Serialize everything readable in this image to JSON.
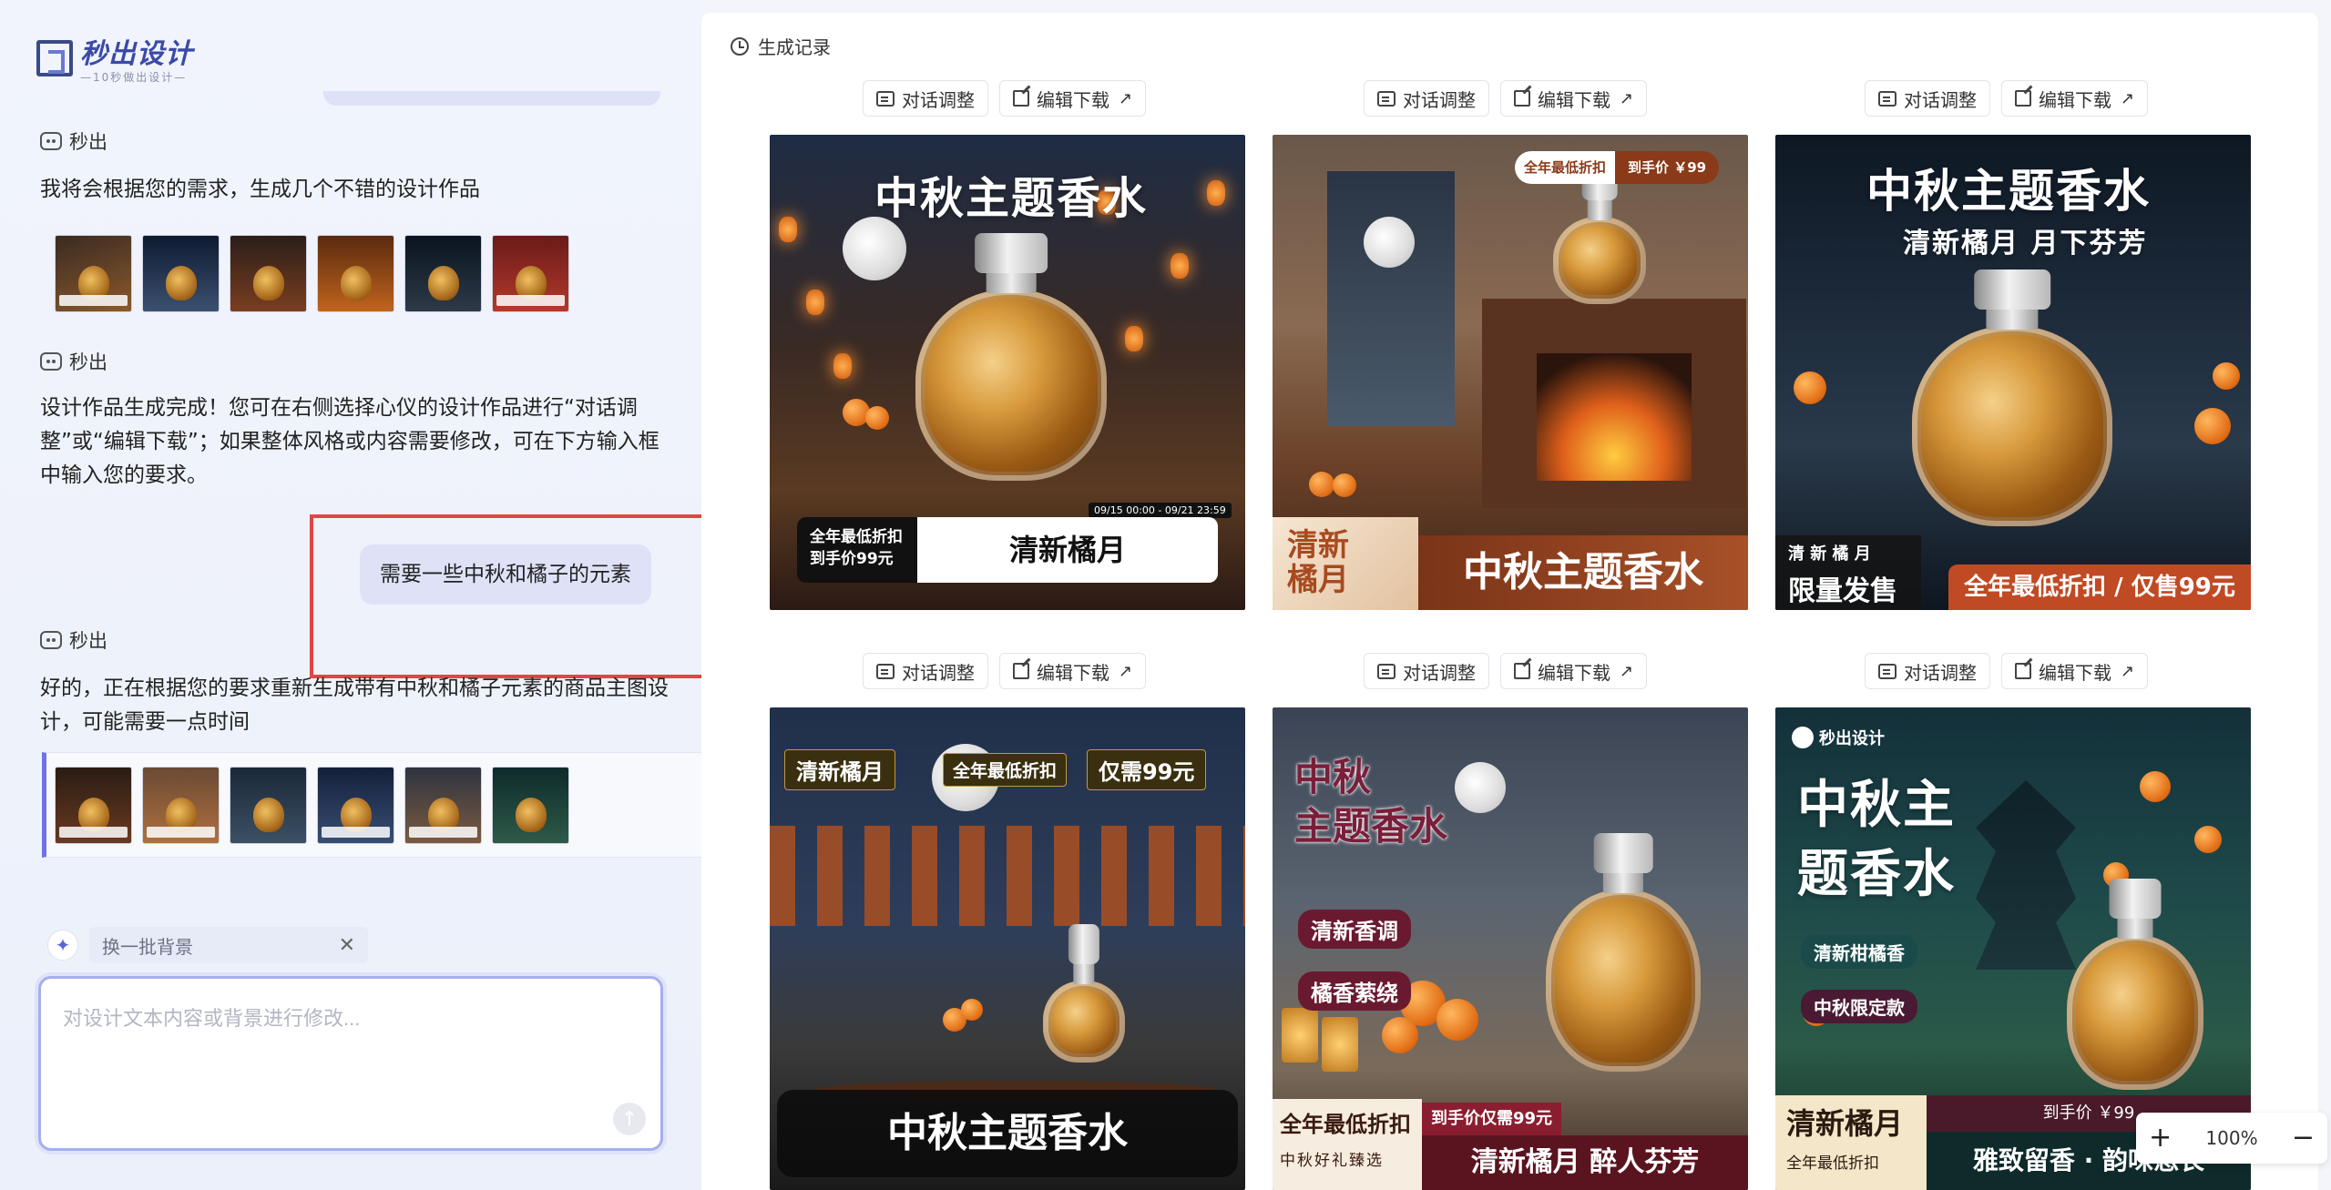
{
  "app": {
    "logo_name": "秒出设计",
    "logo_sub": "—10秒做出设计—"
  },
  "chat": {
    "bot_name": "秒出",
    "msg1": "我将会根据您的需求，生成几个不错的设计作品",
    "msg2": "设计作品生成完成！您可在右侧选择心仪的设计作品进行“对话调整”或“编辑下载”；如果整体风格或内容需要修改，可在下方输入框中输入您的要求。",
    "user_msg": "需要一些中秋和橘子的元素",
    "msg3": "好的，正在根据您的要求重新生成带有中秋和橘子元素的商品主图设计，可能需要一点时间",
    "chip_label": "换一批背景",
    "input_placeholder": "对设计文本内容或背景进行修改..."
  },
  "gallery": {
    "title": "生成记录",
    "chat_adjust": "对话调整",
    "edit_download": "编辑下载",
    "zoom": "100%",
    "watermark": "秒出设计",
    "posters": [
      {
        "title": "中秋主题香水",
        "badge": "全年最低折扣\n到手价99元",
        "tag": "清新橘月",
        "date": "09/15 00:00 - 09/21 23:59"
      },
      {
        "pill1": "全年最低折扣",
        "pill2": "到手价 ￥99",
        "corner": "清新\n橘月",
        "title": "中秋主题香水"
      },
      {
        "title": "中秋主题香水",
        "subtitle": "清新橘月 月下芬芳",
        "spaced": "清 新 橘 月",
        "limit": "限量发售",
        "promo": "全年最低折扣 / 仅售99元"
      },
      {
        "tag1": "清新橘月",
        "tag2": "全年最低折扣",
        "tag3": "仅需99元",
        "title": "中秋主题香水"
      },
      {
        "title": "中秋\n主题香水",
        "tag1": "清新香调",
        "tag2": "橘香萦绕",
        "promo1": "全年最低折扣",
        "promo2": "到手价仅需99元",
        "sub": "中秋好礼臻选",
        "footer": "清新橘月 醉人芬芳"
      },
      {
        "brand": "秒出设计",
        "title": "中秋主\n题香水",
        "tag1": "清新柑橘香",
        "tag2": "中秋限定款",
        "corner": "清新橘月",
        "corner_sub": "全年最低折扣",
        "price": "到手价 ￥99",
        "footer": "雅致留香 · 韵味悠长"
      }
    ]
  }
}
